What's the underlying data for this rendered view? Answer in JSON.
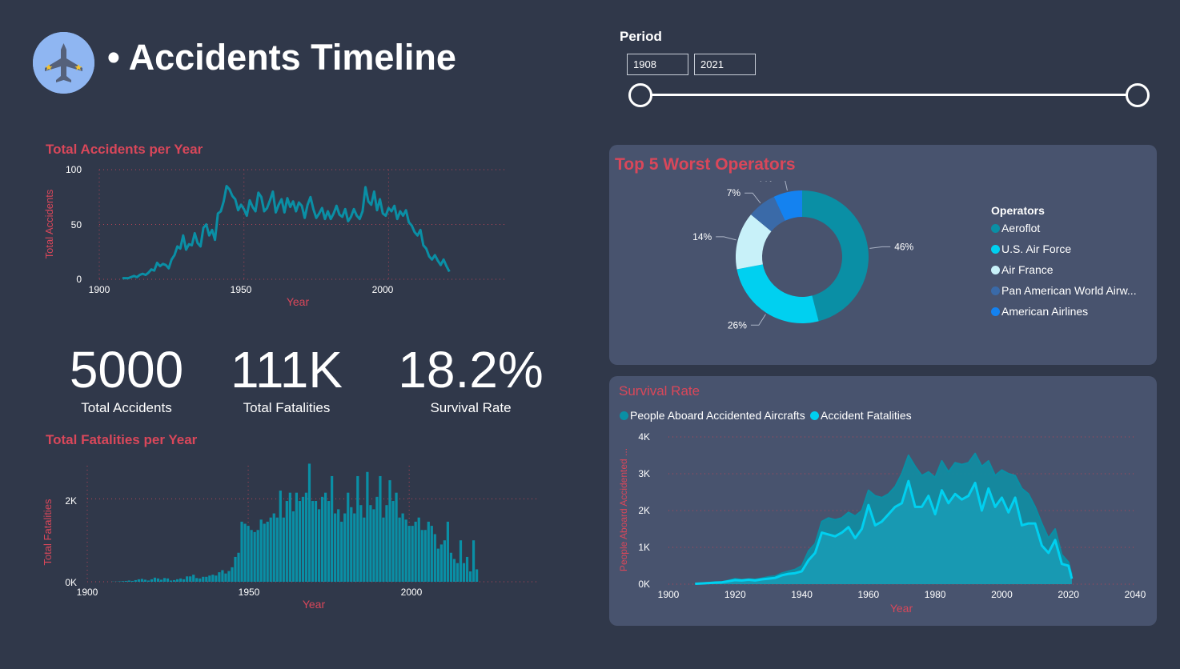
{
  "header": {
    "title": "• Accidents Timeline",
    "period_label": "Period",
    "period_start": "1908",
    "period_end": "2021"
  },
  "kpis": [
    {
      "value": "5000",
      "label": "Total Accidents"
    },
    {
      "value": "111K",
      "label": "Total Fatalities"
    },
    {
      "value": "18.2%",
      "label": "Survival Rate"
    }
  ],
  "colors": {
    "accent": "#d9475a",
    "teal": "#0a8fa5",
    "cyan": "#00d0f0",
    "bg": "#30384a",
    "panel": "#48536e"
  },
  "chart_accidents": {
    "title": "Total Accidents per Year",
    "xlabel": "Year",
    "ylabel": "Total Accidents",
    "y_ticks": [
      "100",
      "50",
      "0"
    ],
    "x_ticks": [
      "1900",
      "1950",
      "2000"
    ],
    "chart_data": {
      "type": "line",
      "xlim": [
        1900,
        2040
      ],
      "ylim": [
        0,
        100
      ],
      "x": [
        1908,
        1909,
        1910,
        1911,
        1912,
        1913,
        1914,
        1915,
        1916,
        1917,
        1918,
        1919,
        1920,
        1921,
        1922,
        1923,
        1924,
        1925,
        1926,
        1927,
        1928,
        1929,
        1930,
        1931,
        1932,
        1933,
        1934,
        1935,
        1936,
        1937,
        1938,
        1939,
        1940,
        1941,
        1942,
        1943,
        1944,
        1945,
        1946,
        1947,
        1948,
        1949,
        1950,
        1951,
        1952,
        1953,
        1954,
        1955,
        1956,
        1957,
        1958,
        1959,
        1960,
        1961,
        1962,
        1963,
        1964,
        1965,
        1966,
        1967,
        1968,
        1969,
        1970,
        1971,
        1972,
        1973,
        1974,
        1975,
        1976,
        1977,
        1978,
        1979,
        1980,
        1981,
        1982,
        1983,
        1984,
        1985,
        1986,
        1987,
        1988,
        1989,
        1990,
        1991,
        1992,
        1993,
        1994,
        1995,
        1996,
        1997,
        1998,
        1999,
        2000,
        2001,
        2002,
        2003,
        2004,
        2005,
        2006,
        2007,
        2008,
        2009,
        2010,
        2011,
        2012,
        2013,
        2014,
        2015,
        2016,
        2017,
        2018,
        2019,
        2020,
        2021
      ],
      "values": [
        1,
        1,
        1,
        2,
        3,
        2,
        4,
        5,
        4,
        6,
        9,
        8,
        15,
        12,
        14,
        13,
        10,
        18,
        22,
        30,
        28,
        40,
        27,
        32,
        31,
        42,
        33,
        30,
        47,
        50,
        40,
        45,
        36,
        60,
        62,
        71,
        85,
        82,
        76,
        73,
        63,
        68,
        64,
        58,
        72,
        66,
        62,
        79,
        75,
        62,
        65,
        72,
        80,
        61,
        68,
        73,
        61,
        74,
        66,
        71,
        62,
        70,
        67,
        56,
        68,
        75,
        64,
        56,
        60,
        65,
        55,
        62,
        55,
        60,
        67,
        59,
        57,
        64,
        53,
        57,
        64,
        58,
        55,
        62,
        84,
        71,
        68,
        80,
        63,
        73,
        60,
        58,
        65,
        62,
        67,
        55,
        62,
        58,
        63,
        52,
        49,
        43,
        40,
        45,
        31,
        28,
        21,
        18,
        22,
        17,
        13,
        18,
        12,
        7,
        6
      ]
    }
  },
  "chart_fatalities": {
    "title": "Total Fatalities per Year",
    "xlabel": "Year",
    "ylabel": "Total Fatalities",
    "y_ticks": [
      "2K",
      "0K"
    ],
    "x_ticks": [
      "1900",
      "1950",
      "2000"
    ],
    "chart_data": {
      "type": "bar",
      "xlim": [
        1900,
        2040
      ],
      "ylim": [
        0,
        2800
      ],
      "x": [
        1908,
        1909,
        1910,
        1911,
        1912,
        1913,
        1914,
        1915,
        1916,
        1917,
        1918,
        1919,
        1920,
        1921,
        1922,
        1923,
        1924,
        1925,
        1926,
        1927,
        1928,
        1929,
        1930,
        1931,
        1932,
        1933,
        1934,
        1935,
        1936,
        1937,
        1938,
        1939,
        1940,
        1941,
        1942,
        1943,
        1944,
        1945,
        1946,
        1947,
        1948,
        1949,
        1950,
        1951,
        1952,
        1953,
        1954,
        1955,
        1956,
        1957,
        1958,
        1959,
        1960,
        1961,
        1962,
        1963,
        1964,
        1965,
        1966,
        1967,
        1968,
        1969,
        1970,
        1971,
        1972,
        1973,
        1974,
        1975,
        1976,
        1977,
        1978,
        1979,
        1980,
        1981,
        1982,
        1983,
        1984,
        1985,
        1986,
        1987,
        1988,
        1989,
        1990,
        1991,
        1992,
        1993,
        1994,
        1995,
        1996,
        1997,
        1998,
        1999,
        2000,
        2001,
        2002,
        2003,
        2004,
        2005,
        2006,
        2007,
        2008,
        2009,
        2010,
        2011,
        2012,
        2013,
        2014,
        2015,
        2016,
        2017,
        2018,
        2019,
        2020,
        2021
      ],
      "values": [
        5,
        5,
        10,
        15,
        20,
        30,
        20,
        40,
        60,
        70,
        50,
        30,
        60,
        100,
        80,
        50,
        90,
        80,
        30,
        40,
        60,
        80,
        60,
        130,
        130,
        170,
        90,
        80,
        120,
        120,
        150,
        170,
        150,
        230,
        280,
        200,
        260,
        350,
        600,
        700,
        1450,
        1400,
        1350,
        1250,
        1200,
        1250,
        1500,
        1400,
        1450,
        1550,
        1650,
        1550,
        2200,
        1550,
        1950,
        2150,
        1700,
        2150,
        1950,
        2050,
        2150,
        2850,
        1950,
        1950,
        1750,
        2050,
        2150,
        1950,
        2550,
        1650,
        1750,
        1450,
        1650,
        2150,
        1800,
        1650,
        2550,
        1850,
        1550,
        2650,
        1850,
        1750,
        2050,
        2550,
        1550,
        1850,
        2450,
        1950,
        2150,
        1550,
        1650,
        1500,
        1350,
        1350,
        1450,
        1550,
        1250,
        1250,
        1450,
        1350,
        1150,
        800,
        900,
        1000,
        1450,
        700,
        550,
        450,
        1000,
        450,
        600,
        250,
        1000,
        300,
        200
      ]
    }
  },
  "operators": {
    "title": "Top 5 Worst Operators",
    "legend_title": "Operators",
    "chart_data": {
      "type": "pie",
      "categories": [
        "Aeroflot",
        "U.S. Air Force",
        "Air France",
        "Pan American World Airw...",
        "American Airlines"
      ],
      "values": [
        46,
        26,
        14,
        7,
        7
      ],
      "labels": [
        "46%",
        "26%",
        "14%",
        "7%",
        "7%"
      ],
      "colors": [
        "#0a8fa5",
        "#00d0f0",
        "#c8f1f9",
        "#3a6aa8",
        "#1482f0"
      ]
    }
  },
  "survival": {
    "title": "Survival Rate",
    "legend": [
      {
        "name": "People Aboard Accidented Aircrafts",
        "color": "#0a8fa5"
      },
      {
        "name": "Accident Fatalities",
        "color": "#00d0f0"
      }
    ],
    "xlabel": "Year",
    "ylabel": "People Aboard Accidented ...",
    "y_ticks": [
      "4K",
      "3K",
      "2K",
      "1K",
      "0K"
    ],
    "x_ticks": [
      "1900",
      "1920",
      "1940",
      "1960",
      "1980",
      "2000",
      "2020",
      "2040"
    ],
    "chart_data": {
      "type": "area",
      "xlim": [
        1900,
        2040
      ],
      "ylim": [
        0,
        4000
      ],
      "x": [
        1908,
        1910,
        1912,
        1914,
        1916,
        1918,
        1920,
        1922,
        1924,
        1926,
        1928,
        1930,
        1932,
        1934,
        1936,
        1938,
        1940,
        1942,
        1944,
        1946,
        1948,
        1950,
        1952,
        1954,
        1956,
        1958,
        1960,
        1962,
        1964,
        1966,
        1968,
        1970,
        1972,
        1974,
        1976,
        1978,
        1980,
        1982,
        1984,
        1986,
        1988,
        1990,
        1992,
        1994,
        1996,
        1998,
        2000,
        2002,
        2004,
        2006,
        2008,
        2010,
        2012,
        2014,
        2016,
        2018,
        2020,
        2021
      ],
      "series": [
        {
          "name": "People Aboard Accidented Aircrafts",
          "values": [
            20,
            30,
            40,
            60,
            60,
            100,
            150,
            120,
            140,
            130,
            160,
            200,
            220,
            300,
            350,
            400,
            500,
            900,
            1100,
            1700,
            1800,
            1750,
            1800,
            1950,
            1850,
            2000,
            2550,
            2400,
            2350,
            2450,
            2650,
            3000,
            3500,
            3200,
            2950,
            3050,
            2900,
            3350,
            3050,
            3300,
            3250,
            3300,
            3550,
            3200,
            3350,
            2950,
            3100,
            3000,
            2950,
            2600,
            2450,
            2100,
            1650,
            1250,
            1500,
            800,
            600,
            250
          ]
        },
        {
          "name": "Accident Fatalities",
          "values": [
            10,
            20,
            30,
            40,
            50,
            80,
            110,
            100,
            120,
            100,
            130,
            150,
            170,
            240,
            280,
            300,
            350,
            650,
            850,
            1400,
            1350,
            1300,
            1400,
            1550,
            1250,
            1500,
            2150,
            1600,
            1700,
            1900,
            2100,
            2200,
            2800,
            2100,
            2100,
            2400,
            1900,
            2550,
            2200,
            2450,
            2300,
            2400,
            2750,
            2000,
            2600,
            2100,
            2350,
            1950,
            2350,
            1600,
            1650,
            1650,
            1050,
            850,
            1200,
            550,
            500,
            150
          ]
        }
      ]
    }
  }
}
